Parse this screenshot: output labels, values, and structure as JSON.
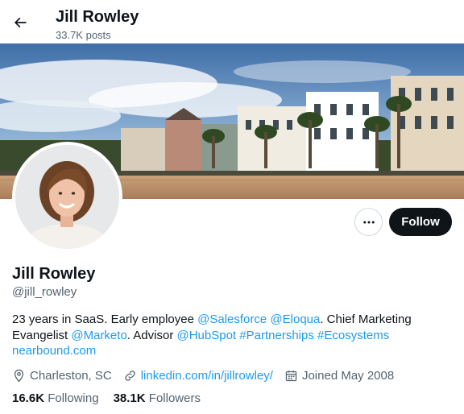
{
  "header": {
    "title": "Jill Rowley",
    "posts": "33.7K posts",
    "back_icon": "arrow-left-icon"
  },
  "profile": {
    "name": "Jill Rowley",
    "handle": "@jill_rowley",
    "more_icon": "more-horizontal-icon",
    "follow_label": "Follow",
    "bio": {
      "line1_text": "23 years in SaaS. Early employee ",
      "mention_salesforce": "@Salesforce",
      "mention_eloqua": "@Eloqua",
      "line1_tail": ". Chief Marketing",
      "line2_text": "Evangelist ",
      "mention_marketo": "@Marketo",
      "line2_mid": ". Advisor ",
      "mention_hubspot": "@HubSpot",
      "tag_partnerships": "#Partnerships",
      "tag_ecosystems": "#Ecosystems",
      "website": "nearbound.com"
    },
    "location": "Charleston, SC",
    "link": "linkedin.com/in/jillrowley/",
    "joined": "Joined May 2008",
    "following_count": "16.6K",
    "following_label": "Following",
    "followers_count": "38.1K",
    "followers_label": "Followers"
  },
  "colors": {
    "link": "#1d9bf0",
    "text": "#0f1419",
    "secondary": "#536471",
    "button_dark": "#0f1419"
  }
}
